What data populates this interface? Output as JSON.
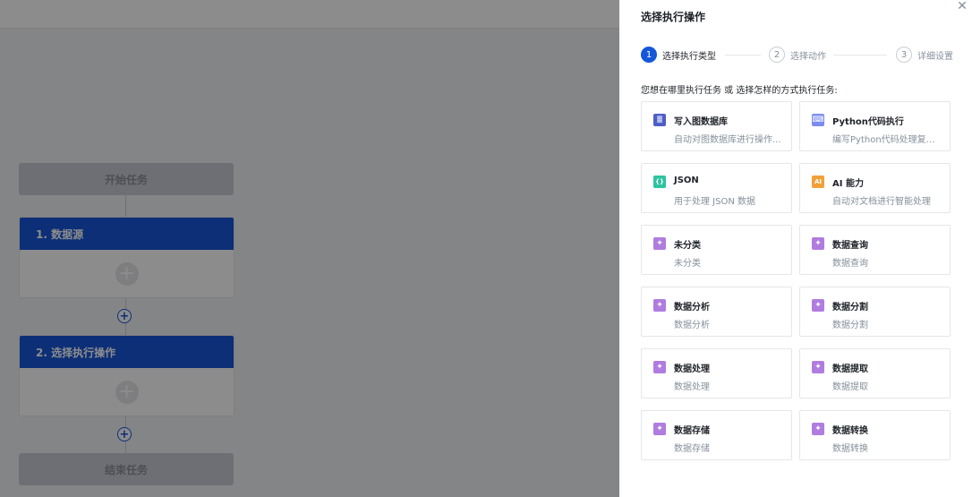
{
  "workflow": {
    "start_label": "开始任务",
    "end_label": "结束任务",
    "nodes": [
      {
        "title": "1. 数据源"
      },
      {
        "title": "2. 选择执行操作"
      }
    ]
  },
  "drawer": {
    "title": "选择执行操作",
    "steps": [
      {
        "num": "1",
        "label": "选择执行类型",
        "state": "active"
      },
      {
        "num": "2",
        "label": "选择动作",
        "state": "idle"
      },
      {
        "num": "3",
        "label": "详细设置",
        "state": "idle"
      }
    ],
    "prompt": "您想在哪里执行任务 或 选择怎样的方式执行任务:",
    "cards": [
      {
        "title": "写入图数据库",
        "desc": "自动对图数据库进行操作...",
        "icon": "database-icon",
        "color": "#4e5ec9"
      },
      {
        "title": "Python代码执行",
        "desc": "编写Python代码处理复杂...",
        "icon": "code-icon",
        "color": "#7b8cf0"
      },
      {
        "title": "JSON",
        "desc": "用于处理 JSON 数据",
        "icon": "json-icon",
        "color": "#2ec4a0"
      },
      {
        "title": "AI 能力",
        "desc": "自动对文档进行智能处理",
        "icon": "ai-icon",
        "color": "#f2a03a"
      },
      {
        "title": "未分类",
        "desc": "未分类",
        "icon": "puzzle-icon",
        "color": "#b07ce0"
      },
      {
        "title": "数据查询",
        "desc": "数据查询",
        "icon": "puzzle-icon",
        "color": "#b07ce0"
      },
      {
        "title": "数据分析",
        "desc": "数据分析",
        "icon": "puzzle-icon",
        "color": "#b07ce0"
      },
      {
        "title": "数据分割",
        "desc": "数据分割",
        "icon": "puzzle-icon",
        "color": "#b07ce0"
      },
      {
        "title": "数据处理",
        "desc": "数据处理",
        "icon": "puzzle-icon",
        "color": "#b07ce0"
      },
      {
        "title": "数据提取",
        "desc": "数据提取",
        "icon": "puzzle-icon",
        "color": "#b07ce0"
      },
      {
        "title": "数据存储",
        "desc": "数据存储",
        "icon": "puzzle-icon",
        "color": "#b07ce0"
      },
      {
        "title": "数据转换",
        "desc": "数据转换",
        "icon": "puzzle-icon",
        "color": "#b07ce0"
      }
    ]
  }
}
